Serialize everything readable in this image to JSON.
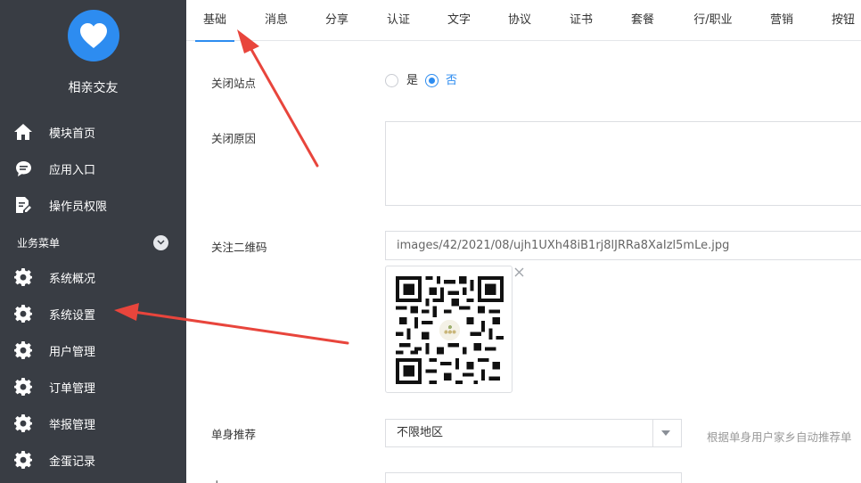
{
  "app": {
    "name": "相亲交友",
    "logo_icon": "heart-icon",
    "accent_color": "#2d8cf0",
    "sidebar_bg": "#393d44"
  },
  "sidebar": {
    "items": [
      {
        "label": "模块首页",
        "icon": "home-icon"
      },
      {
        "label": "应用入口",
        "icon": "chat-bubble-icon"
      },
      {
        "label": "操作员权限",
        "icon": "document-edit-icon"
      }
    ],
    "group_label": "业务菜单",
    "group_items": [
      {
        "label": "系统概况",
        "icon": "gear-icon"
      },
      {
        "label": "系统设置",
        "icon": "gear-icon"
      },
      {
        "label": "用户管理",
        "icon": "gear-icon"
      },
      {
        "label": "订单管理",
        "icon": "gear-icon"
      },
      {
        "label": "举报管理",
        "icon": "gear-icon"
      },
      {
        "label": "金蛋记录",
        "icon": "gear-icon"
      }
    ]
  },
  "tabs": [
    "基础",
    "消息",
    "分享",
    "认证",
    "文字",
    "协议",
    "证书",
    "套餐",
    "行/职业",
    "营销",
    "按钮"
  ],
  "active_tab": "基础",
  "form": {
    "close_site": {
      "label": "关闭站点",
      "options": [
        "是",
        "否"
      ],
      "selected": "否"
    },
    "close_reason": {
      "label": "关闭原因",
      "value": ""
    },
    "qrcode": {
      "label": "关注二维码",
      "path": "images/42/2021/08/ujh1UXh48iB1rj8lJRRa8XaIzl5mLe.jpg",
      "remove_icon": "close-icon"
    },
    "single_recommend": {
      "label": "单身推荐",
      "value": "不限地区",
      "hint": "根据单身用户家乡自动推荐单"
    },
    "next_label": "本"
  }
}
